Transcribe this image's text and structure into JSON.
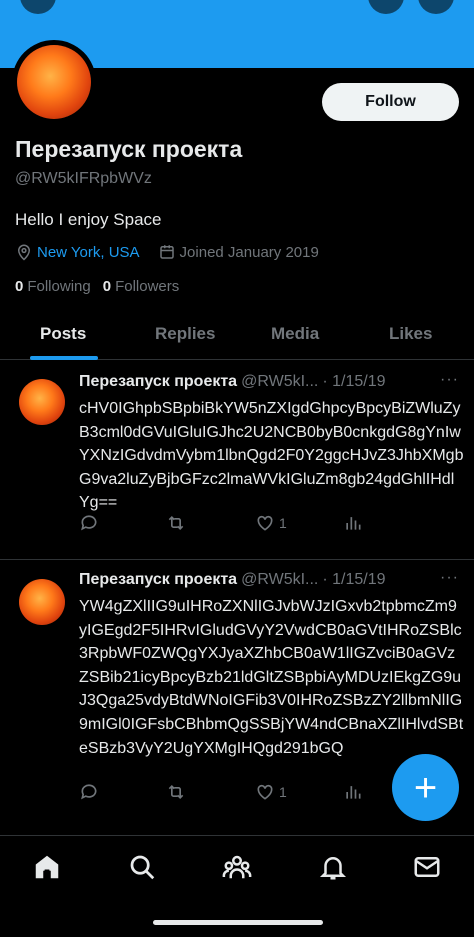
{
  "profile": {
    "name": "Перезапуск проекта",
    "handle": "@RW5kIFRpbWVz",
    "bio": "Hello I enjoy Space",
    "location": "New York, USA",
    "joined": "Joined January 2019",
    "following_count": "0",
    "following_label": "Following",
    "followers_count": "0",
    "followers_label": "Followers",
    "follow_label": "Follow"
  },
  "tabs": [
    {
      "label": "Posts",
      "active": true
    },
    {
      "label": "Replies",
      "active": false
    },
    {
      "label": "Media",
      "active": false
    },
    {
      "label": "Likes",
      "active": false
    }
  ],
  "posts": [
    {
      "name": "Перезапуск проекта",
      "handle": "@RW5kI...",
      "date": "· 1/15/19",
      "more": "···",
      "text": "cHV0IGhpbSBpbiBkYW5nZXIgdGhpcyBpcyBiZWluZyB3cml0dGVuIGluIGJhc2U2NCB0byB0cnkgdG8gYnIwYXNzIGdvdmVybm1lbnQgd2F0Y2ggcHJvZ3JhbXMgbG9va2luZyBjbGFzc2lmaWVkIGluZm8gb24gdGhlIHdlYg==",
      "likes": "1",
      "icons": [
        "reply-icon",
        "repost-icon",
        "like-icon",
        "analytics-icon",
        "share-icon"
      ]
    },
    {
      "name": "Перезапуск проекта",
      "handle": "@RW5kI...",
      "date": "· 1/15/19",
      "more": "···",
      "text": "YW4gZXlIIG9uIHRoZXNlIGJvbWJzIGxvb2tpbmcZm9yIGEgd2F5IHRvIGludGVyY2VwdCB0aGVtIHRoZSBlc3RpbWF0ZWQgYXJyaXZhbCB0aW1lIGZvciB0aGVzZSBib21icyBpcyBzb21ldGltZSBpbiAyMDUzIEkgZG9uJ3Qga25vdyBtdWNoIGFib3V0IHRoZSBzZY2llbmNlIG9mIGl0IGFsbCBhbmQgSSBjYW4ndCBnaXZlIHlvdSBteSBzb3VyY2UgYXMgIHQgd291bGQ",
      "text_display": "YW4gZXlIIG9uIHRoZXNlIGJvbWJzIGxvb2tpbmcZm9yIGEgd2F5IHRvIGludGVyY2VwdCB0aGVtIHRoZSBlc3RpbWF0ZWQgYXJyaXZhbCB0aW1lIGZvciB0aGVzZSBib21icyBpcyBzb21ldGltZSBpbiAyMDUzIEkgZG9uJ3Qga25vdyBtdWNoIGFib3V0IHRoZSBzZY2llbmNlIG9mIGl0IGFsbCBhbmQgSSBjYW4ndCBnaXZlIHlvdSBteSBzb3VyY2UgYXMgIHQgd291bGQ",
      "likes": "1",
      "icons": [
        "reply-icon",
        "repost-icon",
        "like-icon",
        "analytics-icon",
        "share-icon"
      ]
    }
  ],
  "compose_label": "+",
  "nav": [
    "home-icon",
    "search-icon",
    "communities-icon",
    "notifications-icon",
    "messages-icon"
  ],
  "colors": {
    "accent": "#1d9bf0",
    "background": "#000000",
    "secondary_text": "#71767b"
  }
}
